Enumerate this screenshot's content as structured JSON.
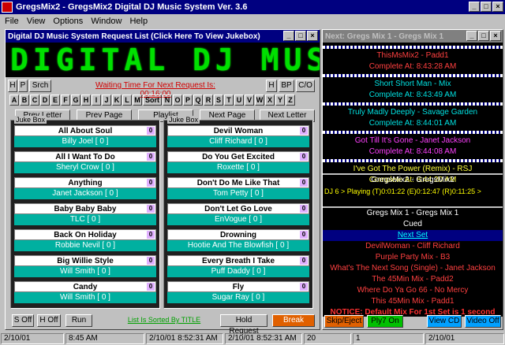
{
  "window": {
    "title": "GregsMix2 - GregsMix2    Digital DJ Music System Ver. 3.6"
  },
  "menu": [
    "File",
    "View",
    "Options",
    "Window",
    "Help"
  ],
  "request": {
    "title": "Digital DJ Music System Request List (Click Here To View Jukebox)",
    "led_text": "DIGITAL DJ MUSI",
    "waiting": "Waiting Time For Next Request Is: 00:16:00",
    "btn_h": "H",
    "btn_p": "P",
    "btn_srch": "Srch",
    "btn_h2": "H",
    "btn_bp": "BP",
    "btn_co": "C/O",
    "letters": [
      "A",
      "B",
      "C",
      "D",
      "E",
      "F",
      "G",
      "H",
      "I",
      "J",
      "K",
      "L",
      "M",
      "Sort",
      "N",
      "O",
      "P",
      "Q",
      "R",
      "S",
      "T",
      "U",
      "V",
      "W",
      "X",
      "Y",
      "Z"
    ],
    "nav": [
      "Prev Letter",
      "Prev Page",
      "Playlist",
      "Next Page",
      "Next Letter"
    ],
    "jukebox_label": "Juke Box",
    "left_songs": [
      {
        "title": "All About Soul",
        "artist": "Billy Joel  [ 0 ]",
        "badge": "0"
      },
      {
        "title": "All I Want To Do",
        "artist": "Sheryl Crow  [ 0 ]",
        "badge": "0"
      },
      {
        "title": "Anything",
        "artist": "Janet Jackson  [ 0 ]",
        "badge": "0"
      },
      {
        "title": "Baby Baby Baby",
        "artist": "TLC  [ 0 ]",
        "badge": "0"
      },
      {
        "title": "Back On Holiday",
        "artist": "Robbie Nevil  [ 0 ]",
        "badge": "0"
      },
      {
        "title": "Big Willie Style",
        "artist": "Will Smith  [ 0 ]",
        "badge": "0"
      },
      {
        "title": "Candy",
        "artist": "Will Smith  [ 0 ]",
        "badge": "0"
      }
    ],
    "right_songs": [
      {
        "title": "Devil Woman",
        "artist": "Cliff Richard  [ 0 ]",
        "badge": "0"
      },
      {
        "title": "Do You Get Excited",
        "artist": "Roxette  [ 0 ]",
        "badge": "0"
      },
      {
        "title": "Don't Do Me Like That",
        "artist": "Tom Petty  [ 0 ]",
        "badge": "0"
      },
      {
        "title": "Don't Let Go Love",
        "artist": "EnVogue  [ 0 ]",
        "badge": "0"
      },
      {
        "title": "Drowning",
        "artist": "Hootie And The Blowfish  [ 0 ]",
        "badge": "0"
      },
      {
        "title": "Every Breath I Take",
        "artist": "Puff Daddy  [ 0 ]",
        "badge": "0"
      },
      {
        "title": "Fly",
        "artist": "Sugar Ray  [ 0 ]",
        "badge": "0"
      }
    ],
    "bottom": {
      "s_off": "S Off",
      "h_off": "H Off",
      "run": "Run",
      "sorted": "List Is Sorted By TITLE",
      "hold": "Hold Request",
      "break": "Break"
    }
  },
  "nextpanel": {
    "title": "Next: Gregs Mix 1 - Gregs Mix 1",
    "queue": [
      {
        "song": "ThisMsMix2 - Padd1",
        "time": "Complete At: 8:43:28 AM",
        "color": "#ff4040"
      },
      {
        "song": "Short Short Man - Mix",
        "time": "Complete At: 8:43:49 AM",
        "color": "#00e0e0"
      },
      {
        "song": "Truly Madly Deeply - Savage Garden",
        "time": "Complete At: 8:44:01 AM",
        "color": "#00e0e0"
      },
      {
        "song": "Got Till It's Gone - Janet Jackson",
        "time": "Complete At: 8:44:08 AM",
        "color": "#ff40ff"
      },
      {
        "song": "I've Got The Power (Remix) - RSJ",
        "time": "Complete At: 8:44:20 AM",
        "color": "#ffff40"
      }
    ],
    "mix2_header": "GregsMix2 - GregsMix2",
    "dj_line": "DJ 6 >  Playing  (T)0:01:22  (E)0:12:47  (R)0:11:25  >",
    "mix1_header": "Gregs Mix 1 - Gregs Mix 1",
    "cued": "Cued",
    "next_set": "Next Set",
    "set_list": [
      {
        "text": "DevilWoman - Cliff Richard",
        "color": "#ff4040"
      },
      {
        "text": "Purple Party Mix - B3",
        "color": "#ff4040"
      },
      {
        "text": "What's The Next Song (Single) - Janet Jackson",
        "color": "#ff4040"
      },
      {
        "text": "The 45Min Mix - Padd2",
        "color": "#ff4040"
      },
      {
        "text": "Where Do Ya Go 66 - No Mercy",
        "color": "#ff4040"
      },
      {
        "text": "This 45Min Mix - Padd1",
        "color": "#ff4040"
      }
    ],
    "notice": "NOTICE: Default Mix For 1st Set is 1 second",
    "buttons": {
      "skip": "Skip/Eject",
      "play": "Ply7 On",
      "view": "View CD",
      "video": "Video Off"
    }
  },
  "statusbar": [
    "2/10/01",
    "8:45 AM",
    "2/10/01 8:52:31 AM",
    "2/10/01 8:52:31 AM",
    "20",
    "1",
    "2/10/01"
  ]
}
